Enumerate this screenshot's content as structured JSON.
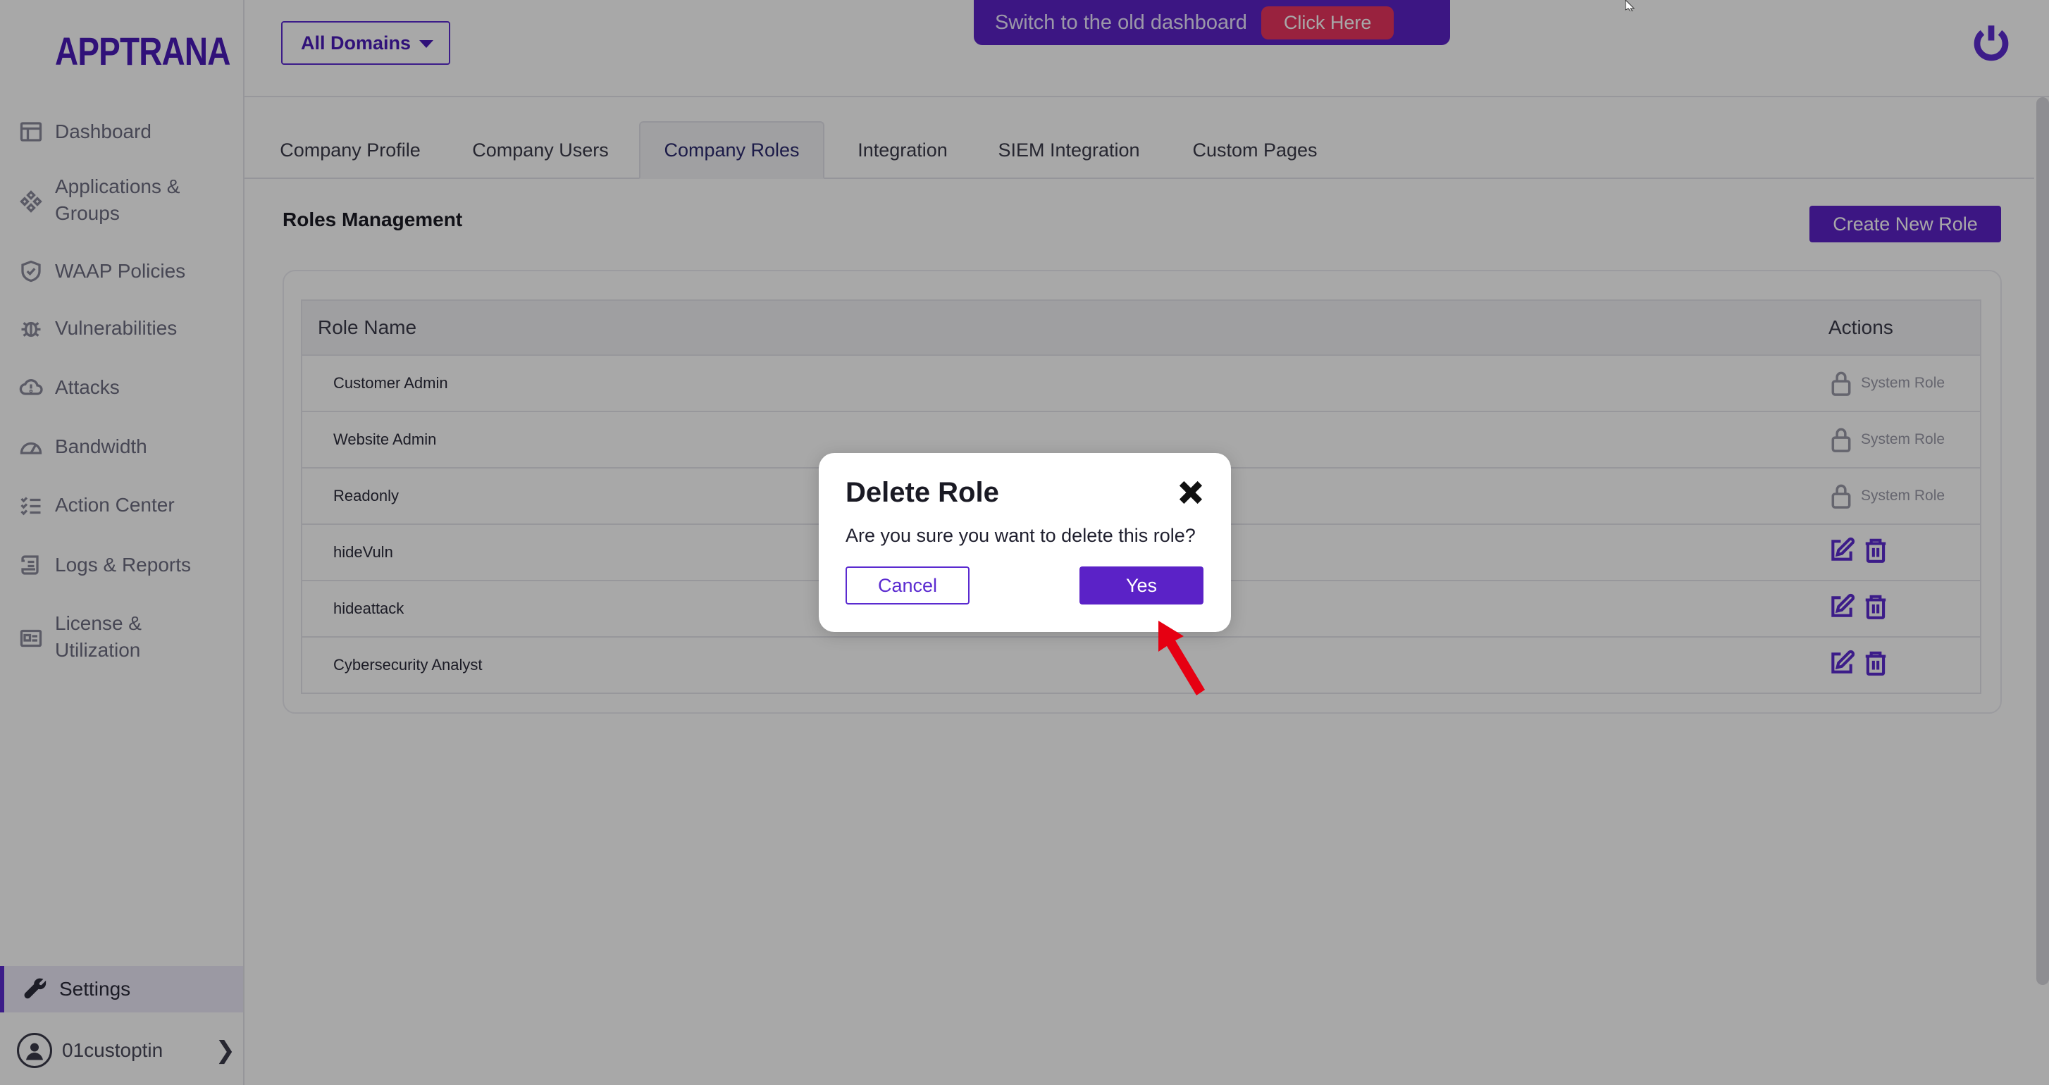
{
  "brand": {
    "logo_text": "APPTRANA"
  },
  "sidebar": {
    "items": [
      {
        "label": "Dashboard",
        "icon": "dashboard-icon"
      },
      {
        "label": "Applications &\nGroups",
        "icon": "applications-icon"
      },
      {
        "label": "WAAP Policies",
        "icon": "shield-icon"
      },
      {
        "label": "Vulnerabilities",
        "icon": "bug-icon"
      },
      {
        "label": "Attacks",
        "icon": "cloud-alert-icon"
      },
      {
        "label": "Bandwidth",
        "icon": "gauge-icon"
      },
      {
        "label": "Action Center",
        "icon": "checklist-icon"
      },
      {
        "label": "Logs & Reports",
        "icon": "scroll-icon"
      },
      {
        "label": "License &\nUtilization",
        "icon": "license-icon"
      }
    ],
    "settings_label": "Settings",
    "user_name": "01custoptin"
  },
  "header": {
    "domain_select": "All Domains",
    "banner_text": "Switch to the old dashboard",
    "banner_button": "Click Here"
  },
  "tabs": [
    {
      "label": "Company Profile"
    },
    {
      "label": "Company Users"
    },
    {
      "label": "Company Roles",
      "active": true
    },
    {
      "label": "Integration"
    },
    {
      "label": "SIEM Integration"
    },
    {
      "label": "Custom Pages"
    }
  ],
  "roles": {
    "title": "Roles Management",
    "create_button": "Create New Role",
    "columns": [
      "Role Name",
      "Actions"
    ],
    "system_role_label": "System Role",
    "rows": [
      {
        "name": "Customer Admin",
        "system": true
      },
      {
        "name": "Website Admin",
        "system": true
      },
      {
        "name": "Readonly",
        "system": true
      },
      {
        "name": "hideVuln",
        "system": false
      },
      {
        "name": "hideattack",
        "system": false
      },
      {
        "name": "Cybersecurity Analyst",
        "system": false
      }
    ]
  },
  "modal": {
    "title": "Delete Role",
    "message": "Are you sure you want to delete this role?",
    "cancel_label": "Cancel",
    "confirm_label": "Yes"
  },
  "colors": {
    "accent": "#5b22c7",
    "banner_button": "#e8345f",
    "annotation_arrow": "#e60012"
  }
}
